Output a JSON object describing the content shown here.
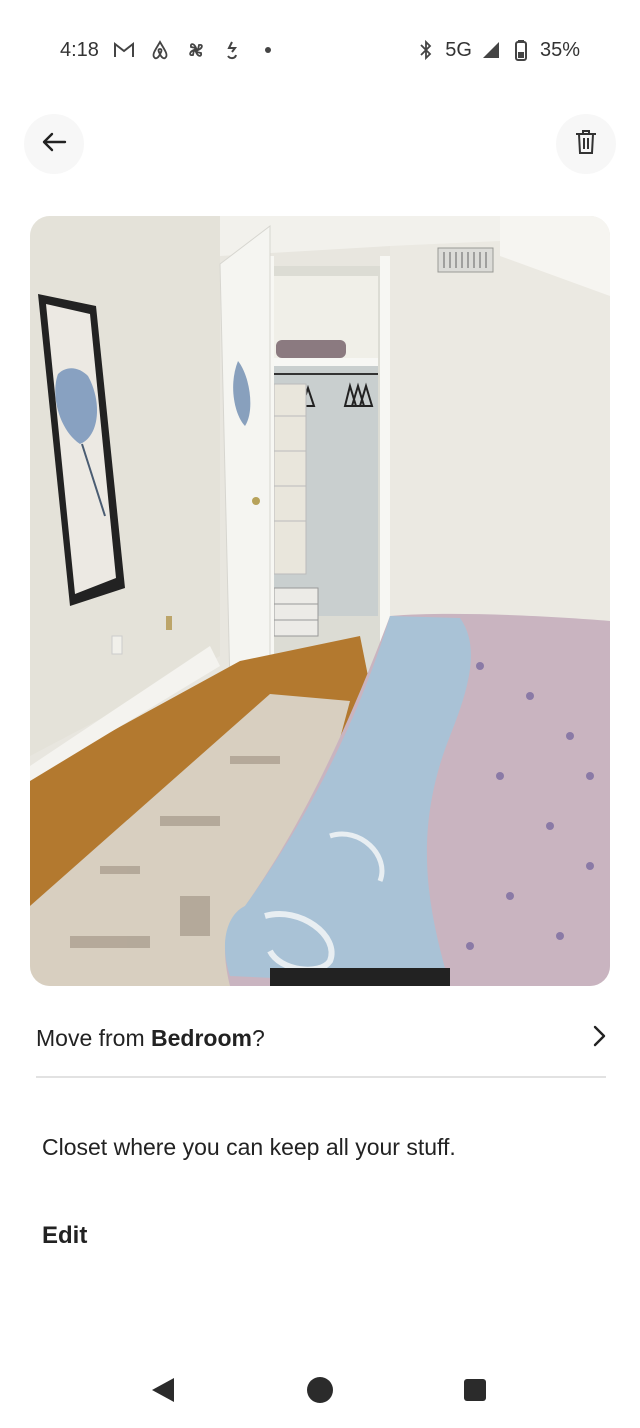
{
  "status_bar": {
    "time": "4:18",
    "network": "5G",
    "battery": "35%",
    "left_icons": [
      "gmail-icon",
      "airbnb-icon",
      "pinwheel-icon",
      "threads-icon",
      "dot-icon"
    ],
    "right_icons": [
      "bluetooth-icon",
      "signal-icon",
      "battery-icon"
    ]
  },
  "header": {
    "back_icon": "arrow-left-icon",
    "delete_icon": "trash-icon"
  },
  "photo": {
    "subject": "bedroom-closet-photo"
  },
  "move": {
    "prefix": "Move from ",
    "room": "Bedroom",
    "suffix": "?",
    "icon": "chevron-right-icon"
  },
  "caption": "Closet where you can keep all your stuff.",
  "edit_label": "Edit",
  "nav": {
    "back": "nav-back-icon",
    "home": "nav-home-icon",
    "recents": "nav-recents-icon"
  },
  "colors": {
    "divider": "#e2e2e2",
    "text": "#222222",
    "button_bg": "#f7f7f7"
  }
}
